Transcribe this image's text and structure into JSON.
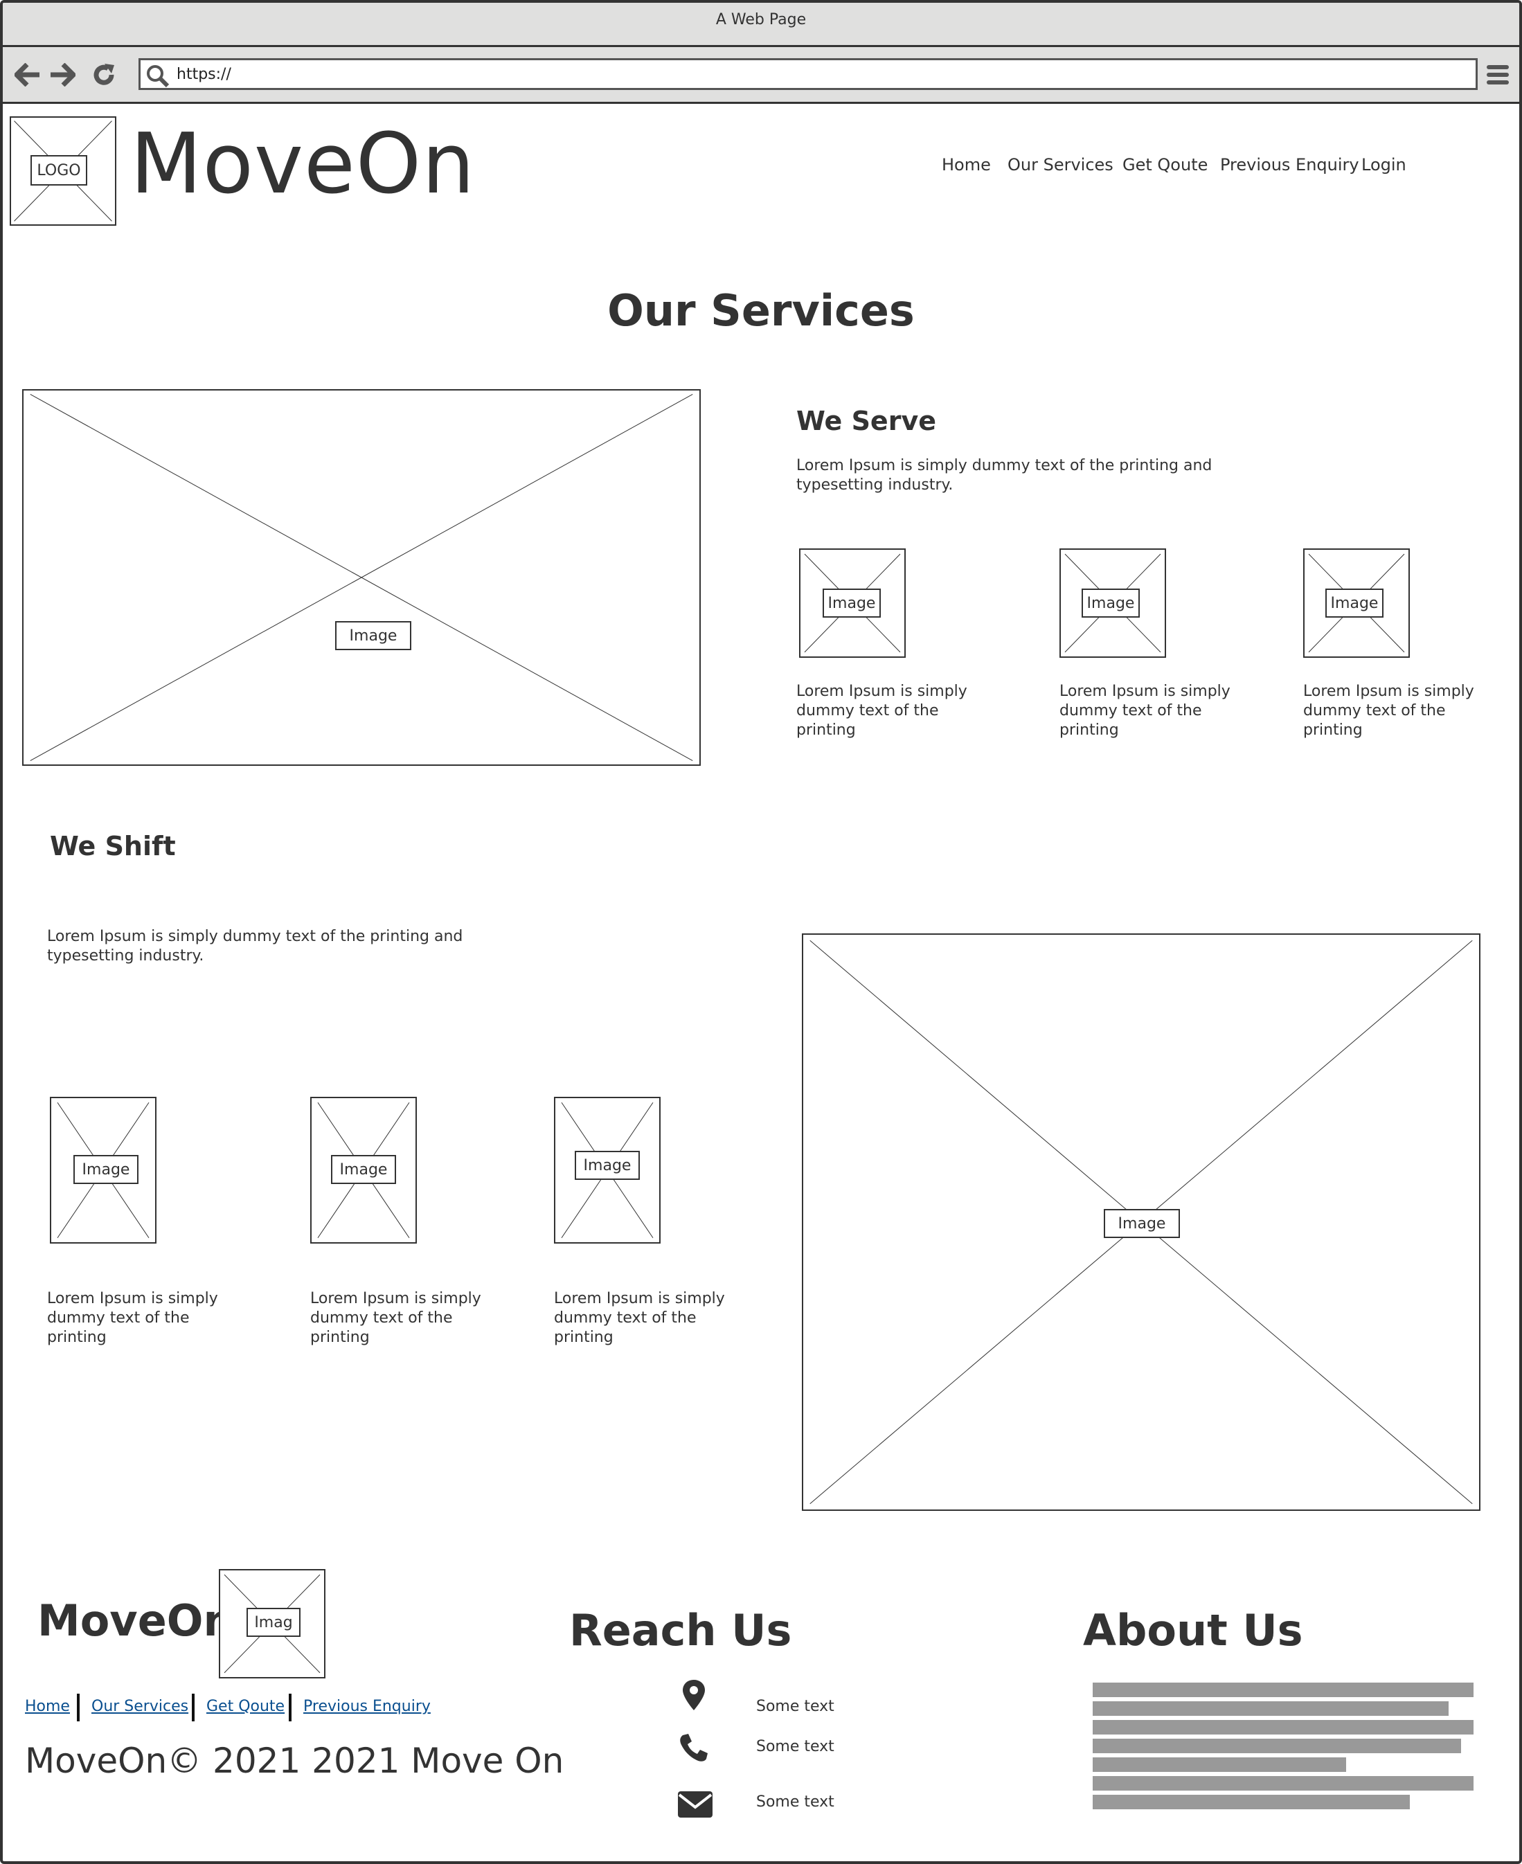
{
  "browser": {
    "window_title": "A Web Page",
    "url": "https://"
  },
  "header": {
    "logo_label": "LOGO",
    "brand": "MoveOn",
    "nav": [
      "Home",
      "Our Services",
      "Get Qoute",
      "Previous Enquiry",
      "Login"
    ]
  },
  "page_title": "Our Services",
  "serve": {
    "image_label": "Image",
    "heading": "We Serve",
    "text": "Lorem Ipsum is simply dummy text of the printing and typesetting industry.",
    "items": [
      {
        "image_label": "Image",
        "text": "Lorem Ipsum is simply dummy text of the printing"
      },
      {
        "image_label": "Image",
        "text": "Lorem Ipsum is simply dummy text of the printing"
      },
      {
        "image_label": "Image",
        "text": "Lorem Ipsum is simply dummy text of the printing"
      }
    ]
  },
  "shift": {
    "heading": "We Shift",
    "text": "Lorem Ipsum is simply dummy text of the printing and typesetting industry.",
    "image_label": "Image",
    "items": [
      {
        "image_label": "Image",
        "text": "Lorem Ipsum is simply dummy text of the printing"
      },
      {
        "image_label": "Image",
        "text": "Lorem Ipsum is simply dummy text of the printing"
      },
      {
        "image_label": "Image",
        "text": "Lorem Ipsum is simply dummy text of the printing"
      }
    ]
  },
  "footer": {
    "brand": "MoveOn",
    "logo_label": "Imag",
    "links": [
      "Home",
      "Our Services",
      "Get Qoute",
      "Previous Enquiry"
    ],
    "copyright": "MoveOn© 2021 2021 Move On",
    "reach_heading": "Reach Us",
    "contacts": [
      {
        "icon": "map-pin-icon",
        "text": "Some text"
      },
      {
        "icon": "phone-icon",
        "text": "Some text"
      },
      {
        "icon": "envelope-icon",
        "text": "Some text"
      }
    ],
    "about_heading": "About Us"
  },
  "colors": {
    "ink": "#333333",
    "chrome": "#e0e0df",
    "link": "#0a4f8f",
    "text_bar": "#999999"
  }
}
